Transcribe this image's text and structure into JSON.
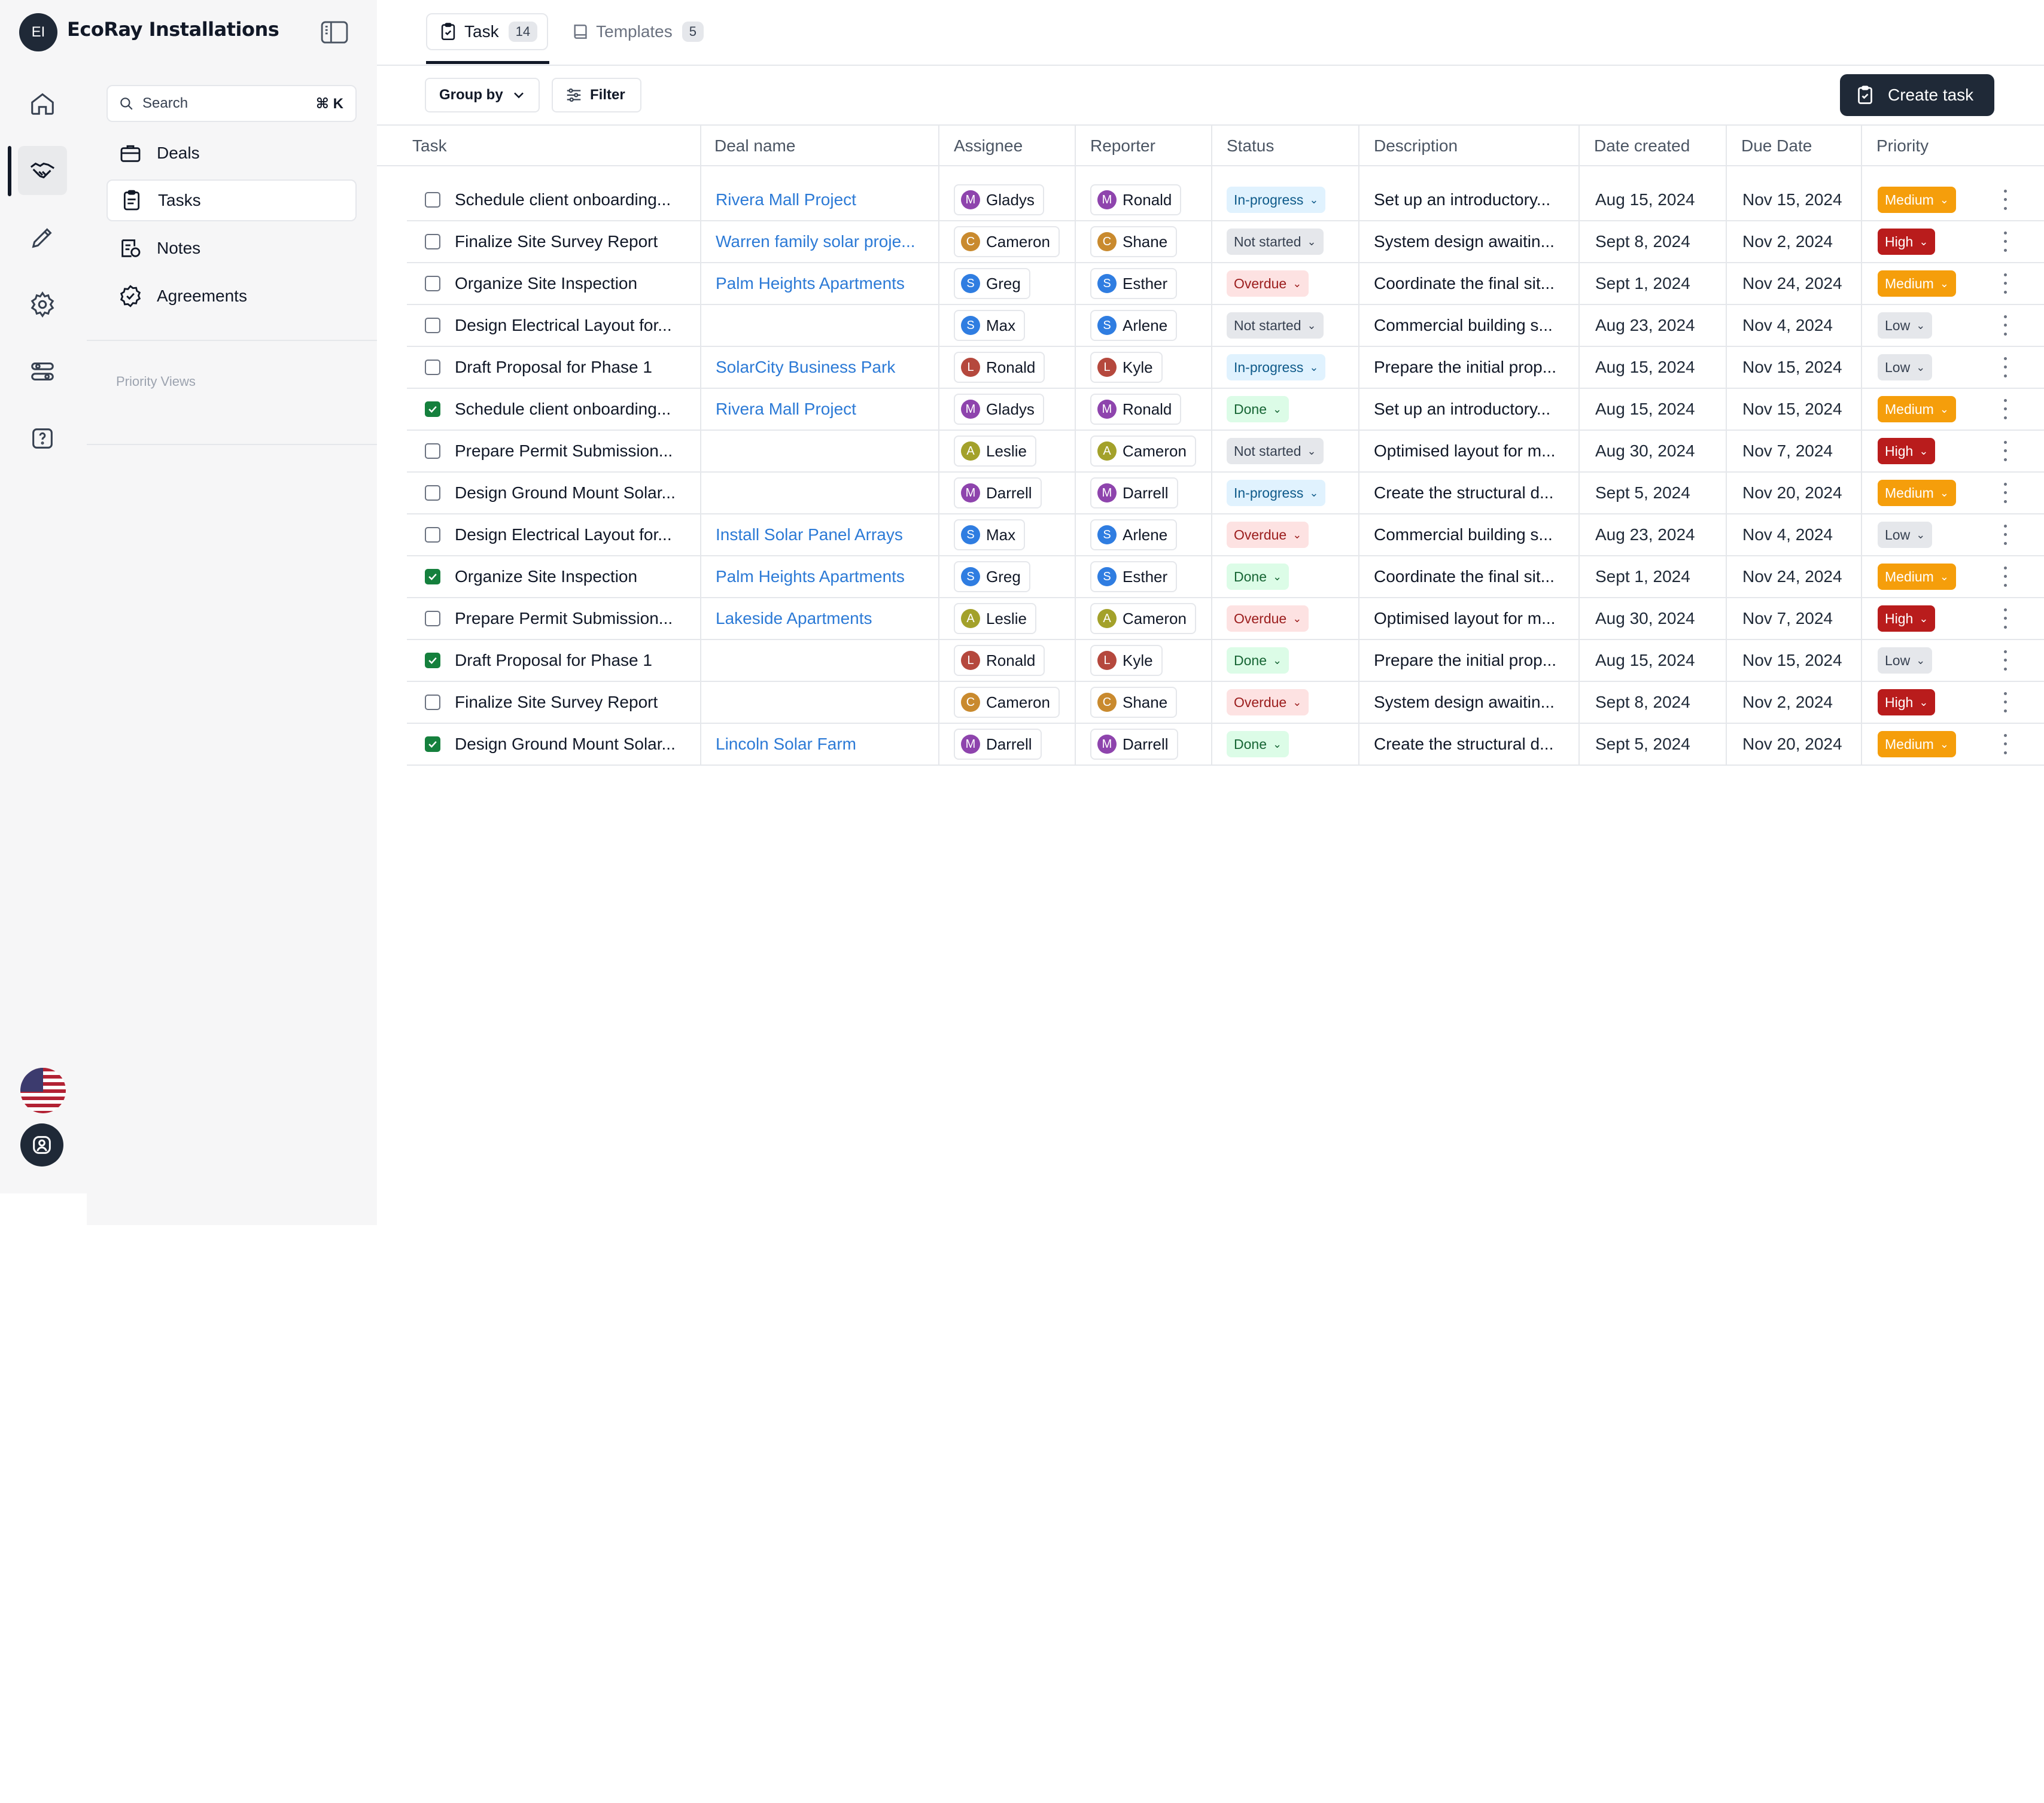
{
  "workspace": {
    "initials": "EI",
    "name": "EcoRay Installations"
  },
  "search": {
    "placeholder": "Search",
    "shortcut": "⌘ K"
  },
  "nav": {
    "items": [
      {
        "label": "Deals",
        "icon": "briefcase-icon"
      },
      {
        "label": "Tasks",
        "icon": "clipboard-icon",
        "active": true
      },
      {
        "label": "Notes",
        "icon": "notes-icon"
      },
      {
        "label": "Agreements",
        "icon": "badge-check-icon"
      }
    ],
    "section_label": "Priority Views"
  },
  "rail": {
    "items": [
      "home-icon",
      "handshake-icon",
      "pencil-icon",
      "gear-icon",
      "toggles-icon",
      "help-icon"
    ],
    "active": "handshake-icon"
  },
  "tabs": [
    {
      "label": "Task",
      "count": "14",
      "active": true
    },
    {
      "label": "Templates",
      "count": "5"
    }
  ],
  "toolbar": {
    "group_by": "Group by",
    "filter": "Filter",
    "create": "Create task"
  },
  "columns": [
    "Task",
    "Deal name",
    "Assignee",
    "Reporter",
    "Status",
    "Description",
    "Date created",
    "Due Date",
    "Priority"
  ],
  "colors": {
    "avatar": {
      "G": "#8e44ad",
      "M": "#8e44ad",
      "R": "#8e44ad",
      "C": "#c98a2e",
      "S": "#2f7de1",
      "L": "#b5483d",
      "K": "#b5483d",
      "A": "#a3a12a",
      "E": "#2f7de1",
      "D": "#8e44ad"
    },
    "status": {
      "In-progress": {
        "bg": "#e0f2fe",
        "fg": "#0e5a8a"
      },
      "Not started": {
        "bg": "#e5e7eb",
        "fg": "#374151"
      },
      "Overdue": {
        "bg": "#fde2e2",
        "fg": "#9b1c1c"
      },
      "Done": {
        "bg": "#dcfce7",
        "fg": "#166534"
      }
    },
    "priority": {
      "Medium": {
        "bg": "#f59e0b",
        "fg": "#ffffff"
      },
      "High": {
        "bg": "#b91c1c",
        "fg": "#ffffff"
      },
      "Low": {
        "bg": "#e5e7eb",
        "fg": "#374151"
      }
    }
  },
  "rows": [
    {
      "done": false,
      "task": "Schedule client onboarding...",
      "deal": "Rivera Mall Project",
      "assignee": "Gladys",
      "assignee_initial": "M",
      "reporter": "Ronald",
      "reporter_initial": "M",
      "status": "In-progress",
      "description": "Set up an introductory...",
      "created": "Aug 15, 2024",
      "due": "Nov 15, 2024",
      "priority": "Medium"
    },
    {
      "done": false,
      "task": "Finalize Site Survey Report",
      "deal": "Warren family solar proje...",
      "assignee": "Cameron",
      "assignee_initial": "C",
      "reporter": "Shane",
      "reporter_initial": "C",
      "status": "Not started",
      "description": "System design awaitin...",
      "created": "Sept 8, 2024",
      "due": "Nov 2, 2024",
      "priority": "High"
    },
    {
      "done": false,
      "task": "Organize Site Inspection",
      "deal": "Palm Heights Apartments",
      "assignee": "Greg",
      "assignee_initial": "S",
      "reporter": "Esther",
      "reporter_initial": "S",
      "status": "Overdue",
      "description": "Coordinate the final sit...",
      "created": "Sept 1, 2024",
      "due": "Nov 24, 2024",
      "priority": "Medium"
    },
    {
      "done": false,
      "task": "Design Electrical Layout for...",
      "deal": "",
      "assignee": "Max",
      "assignee_initial": "S",
      "reporter": "Arlene",
      "reporter_initial": "S",
      "status": "Not started",
      "description": "Commercial building s...",
      "created": "Aug 23, 2024",
      "due": "Nov 4, 2024",
      "priority": "Low"
    },
    {
      "done": false,
      "task": "Draft Proposal for Phase 1",
      "deal": "SolarCity Business Park",
      "assignee": "Ronald",
      "assignee_initial": "L",
      "reporter": "Kyle",
      "reporter_initial": "L",
      "status": "In-progress",
      "description": "Prepare the initial prop...",
      "created": "Aug 15, 2024",
      "due": "Nov 15, 2024",
      "priority": "Low"
    },
    {
      "done": true,
      "task": "Schedule client onboarding...",
      "deal": "Rivera Mall Project",
      "assignee": "Gladys",
      "assignee_initial": "M",
      "reporter": "Ronald",
      "reporter_initial": "M",
      "status": "Done",
      "description": "Set up an introductory...",
      "created": "Aug 15, 2024",
      "due": "Nov 15, 2024",
      "priority": "Medium"
    },
    {
      "done": false,
      "task": "Prepare Permit Submission...",
      "deal": "",
      "assignee": "Leslie",
      "assignee_initial": "A",
      "reporter": "Cameron",
      "reporter_initial": "A",
      "status": "Not started",
      "description": "Optimised layout for m...",
      "created": "Aug 30, 2024",
      "due": "Nov 7, 2024",
      "priority": "High"
    },
    {
      "done": false,
      "task": "Design Ground Mount Solar...",
      "deal": "",
      "assignee": "Darrell",
      "assignee_initial": "M",
      "reporter": "Darrell",
      "reporter_initial": "M",
      "status": "In-progress",
      "description": "Create the structural d...",
      "created": "Sept 5, 2024",
      "due": "Nov 20, 2024",
      "priority": "Medium"
    },
    {
      "done": false,
      "task": "Design Electrical Layout for...",
      "deal": "Install Solar Panel Arrays",
      "assignee": "Max",
      "assignee_initial": "S",
      "reporter": "Arlene",
      "reporter_initial": "S",
      "status": "Overdue",
      "description": "Commercial building s...",
      "created": "Aug 23, 2024",
      "due": "Nov 4, 2024",
      "priority": "Low"
    },
    {
      "done": true,
      "task": "Organize Site Inspection",
      "deal": "Palm Heights Apartments",
      "assignee": "Greg",
      "assignee_initial": "S",
      "reporter": "Esther",
      "reporter_initial": "S",
      "status": "Done",
      "description": "Coordinate the final sit...",
      "created": "Sept 1, 2024",
      "due": "Nov 24, 2024",
      "priority": "Medium"
    },
    {
      "done": false,
      "task": "Prepare Permit Submission...",
      "deal": "Lakeside Apartments",
      "assignee": "Leslie",
      "assignee_initial": "A",
      "reporter": "Cameron",
      "reporter_initial": "A",
      "status": "Overdue",
      "description": "Optimised layout for m...",
      "created": "Aug 30, 2024",
      "due": "Nov 7, 2024",
      "priority": "High"
    },
    {
      "done": true,
      "task": "Draft Proposal for Phase 1",
      "deal": "",
      "assignee": "Ronald",
      "assignee_initial": "L",
      "reporter": "Kyle",
      "reporter_initial": "L",
      "status": "Done",
      "description": "Prepare the initial prop...",
      "created": "Aug 15, 2024",
      "due": "Nov 15, 2024",
      "priority": "Low"
    },
    {
      "done": false,
      "task": "Finalize Site Survey Report",
      "deal": "",
      "assignee": "Cameron",
      "assignee_initial": "C",
      "reporter": "Shane",
      "reporter_initial": "C",
      "status": "Overdue",
      "description": "System design awaitin...",
      "created": "Sept 8, 2024",
      "due": "Nov 2, 2024",
      "priority": "High"
    },
    {
      "done": true,
      "task": "Design Ground Mount Solar...",
      "deal": "Lincoln Solar Farm",
      "assignee": "Darrell",
      "assignee_initial": "M",
      "reporter": "Darrell",
      "reporter_initial": "M",
      "status": "Done",
      "description": "Create the structural d...",
      "created": "Sept 5, 2024",
      "due": "Nov 20, 2024",
      "priority": "Medium"
    }
  ]
}
